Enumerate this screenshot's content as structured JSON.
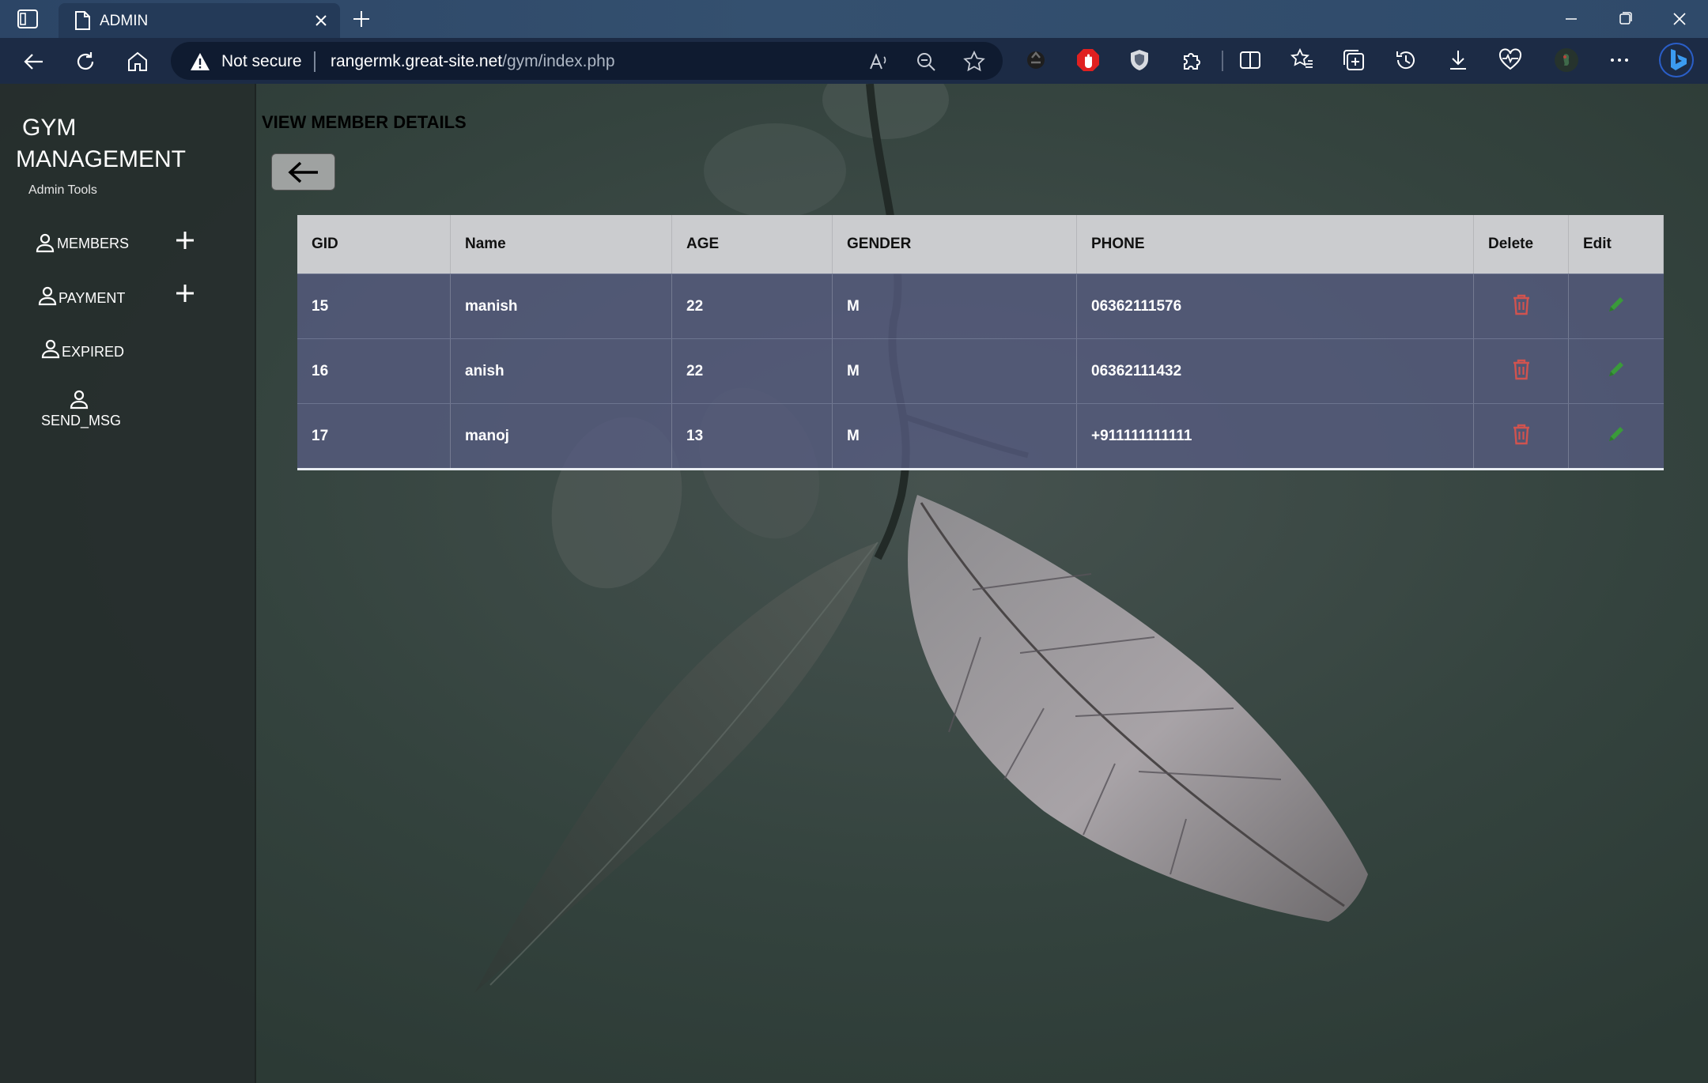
{
  "browser": {
    "tab_title": "ADMIN",
    "address": {
      "security_label": "Not secure",
      "url_host": "rangermk.great-site.net",
      "url_path": "/gym/index.php"
    },
    "toolbar_icons": [
      "read-aloud-icon",
      "zoom-out-icon",
      "favorite-star-icon",
      "extension-recycle-icon",
      "adblock-icon",
      "shield-icon",
      "extensions-icon",
      "split-screen-icon",
      "favorites-icon",
      "collections-icon",
      "history-icon",
      "downloads-icon",
      "performance-icon",
      "profile-avatar",
      "more-icon",
      "bing-copilot-icon"
    ]
  },
  "sidebar": {
    "brand_line1": "GYM",
    "brand_line2": "MANAGEMENT",
    "subtitle": "Admin Tools",
    "items": [
      {
        "label": "MEMBERS",
        "has_add": true
      },
      {
        "label": "PAYMENT",
        "has_add": true
      },
      {
        "label": "EXPIRED",
        "has_add": false
      },
      {
        "label": "SEND_MSG",
        "has_add": false
      }
    ]
  },
  "main": {
    "heading": "VIEW MEMBER DETAILS",
    "table": {
      "headers": [
        "GID",
        "Name",
        "AGE",
        "GENDER",
        "PHONE",
        "Delete",
        "Edit"
      ],
      "rows": [
        {
          "gid": "15",
          "name": "manish",
          "age": "22",
          "gender": "M",
          "phone": "06362111576"
        },
        {
          "gid": "16",
          "name": "anish",
          "age": "22",
          "gender": "M",
          "phone": "06362111432"
        },
        {
          "gid": "17",
          "name": "manoj",
          "age": "13",
          "gender": "M",
          "phone": "+911111111111"
        }
      ]
    }
  },
  "colors": {
    "delete_icon": "#d0534f",
    "edit_icon": "#3a9a3a",
    "row_bg": "#575c82",
    "header_bg": "#cbcccf",
    "sidebar_bg": "#262e2c"
  }
}
